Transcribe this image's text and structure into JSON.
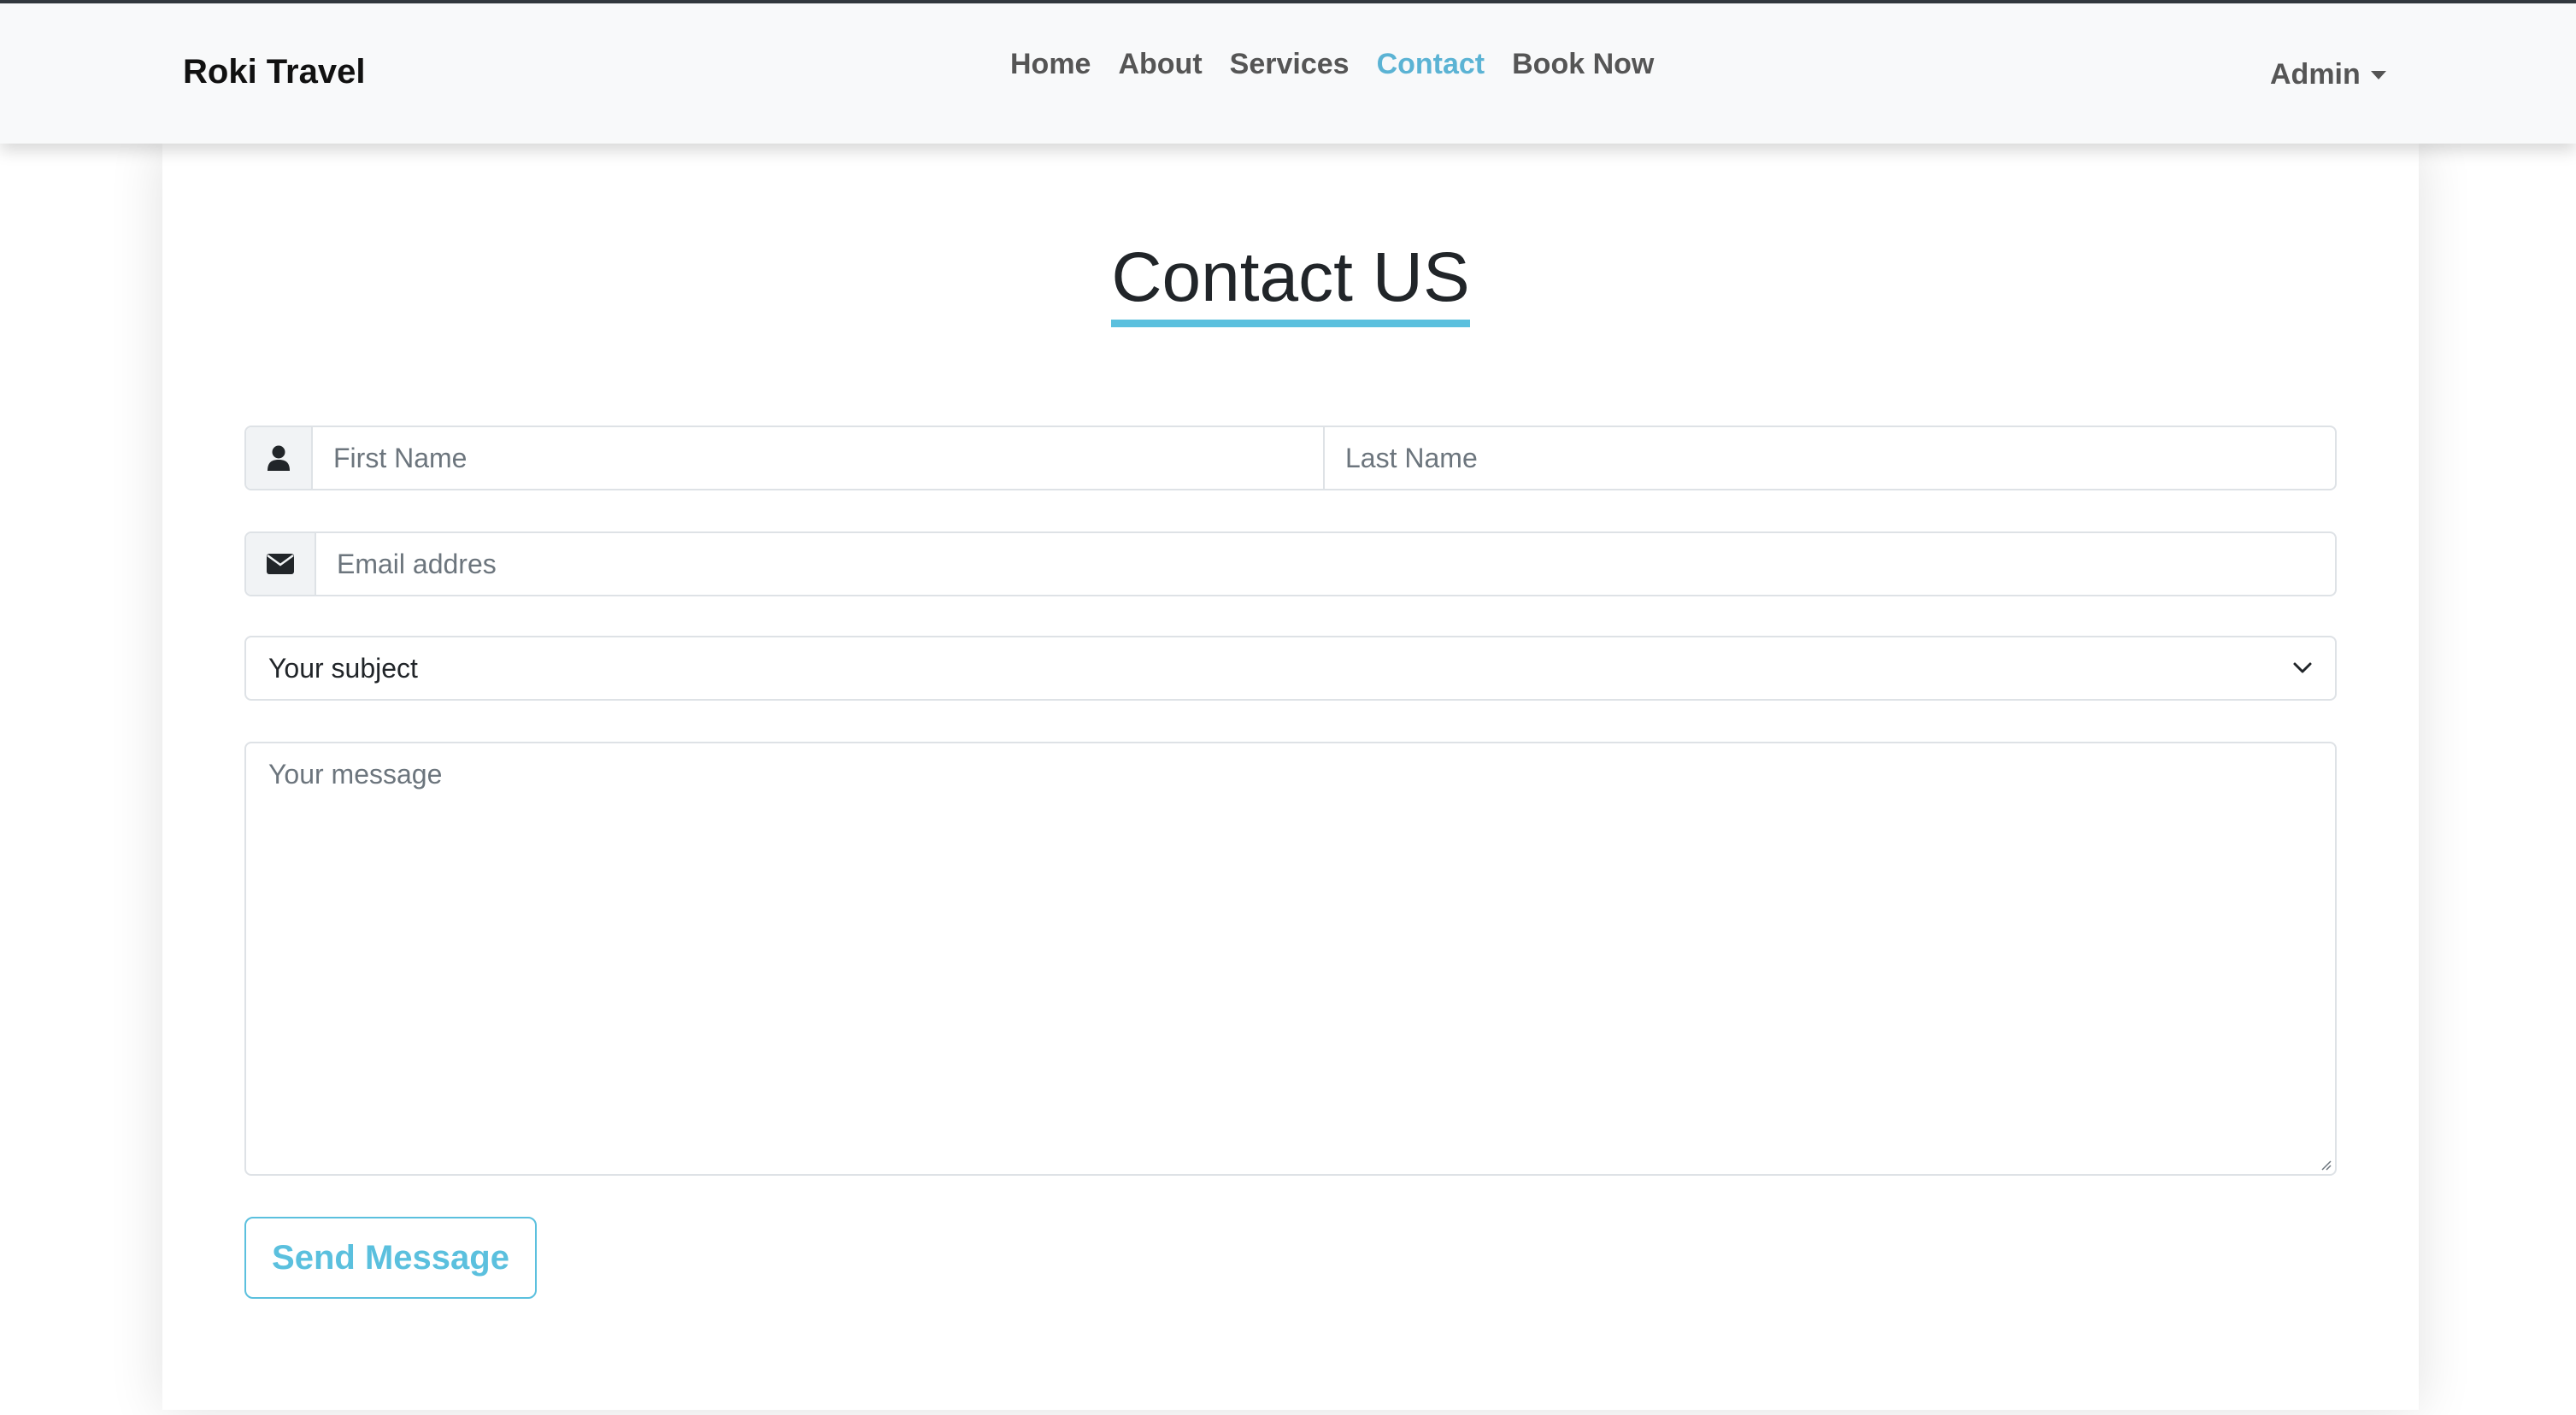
{
  "navbar": {
    "brand": "Roki Travel",
    "links": [
      {
        "label": "Home"
      },
      {
        "label": "About"
      },
      {
        "label": "Services"
      },
      {
        "label": "Contact"
      },
      {
        "label": "Book Now"
      }
    ],
    "active_link": "Contact",
    "user_menu": "Admin"
  },
  "form": {
    "title": "Contact US",
    "first_name_placeholder": "First Name",
    "last_name_placeholder": "Last Name",
    "email_placeholder": "Email addres",
    "subject_selected": "Your subject",
    "message_placeholder": "Your message",
    "submit_label": "Send Message"
  },
  "icons": {
    "name_field": "user-icon",
    "email_field": "envelope-icon",
    "select": "chevron-down-icon"
  },
  "colors": {
    "accent": "#5bc0de",
    "active_link": "#5bb3d4",
    "navbar_bg": "#f8f9fa"
  }
}
